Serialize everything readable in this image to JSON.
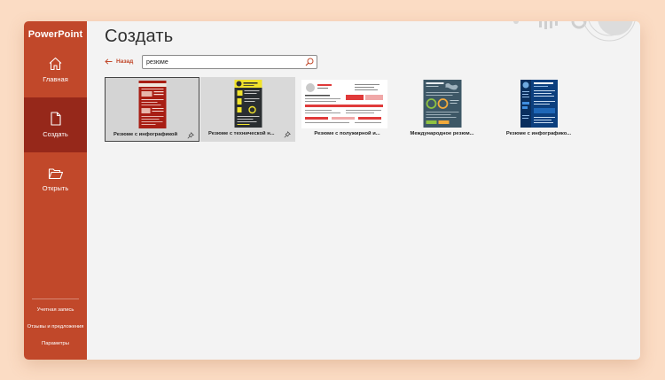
{
  "app": {
    "name": "PowerPoint"
  },
  "sidebar": {
    "items": [
      {
        "label": "Главная",
        "icon": "home-icon"
      },
      {
        "label": "Создать",
        "icon": "new-document-icon"
      },
      {
        "label": "Открыть",
        "icon": "open-folder-icon"
      }
    ],
    "bottom": [
      {
        "label": "Учетная запись"
      },
      {
        "label": "Отзывы и предложения"
      },
      {
        "label": "Параметры"
      }
    ]
  },
  "main": {
    "title": "Создать",
    "back_label": "Назад",
    "search": {
      "value": "резюме",
      "placeholder": ""
    }
  },
  "templates": [
    {
      "label": "Резюме с инфографикой",
      "pinnable": true
    },
    {
      "label": "Резюме с технической н...",
      "pinnable": true
    },
    {
      "label": "Резюме с полужирной и...",
      "pinnable": false
    },
    {
      "label": "Международное резюм...",
      "pinnable": false
    },
    {
      "label": "Резюме с инфографико...",
      "pinnable": false
    }
  ],
  "colors": {
    "accent": "#c1482a",
    "accent_dark": "#96281a",
    "background": "#f3f3f3",
    "page_bg": "#fbdcc4"
  }
}
